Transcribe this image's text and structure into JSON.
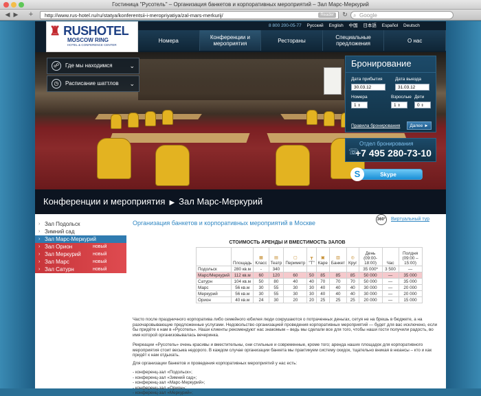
{
  "browser": {
    "title": "Гостиница \"Русотель\" – Организация банкетов и корпоративных мероприятий – Зал Марс-Меркурий",
    "url": "http://www.rus-hotel.ru/ru/statya/konferentsii-i-meropriyatiya/zal-mars-merkurij/",
    "reader": "Reader",
    "search_placeholder": "Google"
  },
  "header": {
    "phone": "8 800 200-05-77",
    "languages": [
      "Русский",
      "English",
      "中国",
      "日本語",
      "Español",
      "Deutsch"
    ],
    "logo": {
      "name": "RUSHOTEL",
      "sub": "MOSCOW RING",
      "tag": "HOTEL & CONFERENCE CENTER"
    },
    "nav": [
      {
        "label": "Номера"
      },
      {
        "label": "Конференции и мероприятия"
      },
      {
        "label": "Рестораны"
      },
      {
        "label": "Специальные предложения"
      },
      {
        "label": "О нас"
      }
    ]
  },
  "hero": {
    "where": "Где мы находимся",
    "shuttle": "Расписание шаттлов"
  },
  "booking": {
    "title": "Бронирование",
    "arrival_label": "Дата прибытия",
    "departure_label": "Дата выезда",
    "arrival": "30.03.12",
    "departure": "31.03.12",
    "rooms_label": "Номера",
    "adults_label": "Взрослые",
    "children_label": "Дети",
    "rooms": "1",
    "adults": "1",
    "children": "0",
    "rules": "Правила бронирования",
    "go": "Далее ►",
    "dept_title": "Отдел бронирования",
    "phone": "+7 495 280-73-10",
    "skype": "Skype"
  },
  "breadcrumb": {
    "section": "Конференции и мероприятия",
    "current": "Зал Марс-Меркурий"
  },
  "menu": {
    "items": [
      {
        "label": "Зал Подольск"
      },
      {
        "label": "Зимний сад"
      },
      {
        "label": "Зал Марс-Меркурий"
      },
      {
        "label": "Зал Орион",
        "badge": "новый"
      },
      {
        "label": "Зал Меркурий",
        "badge": "новый"
      },
      {
        "label": "Зал Марс",
        "badge": "новый"
      },
      {
        "label": "Зал Сатурн",
        "badge": "новый"
      }
    ]
  },
  "main": {
    "title": "Организация банкетов и корпоративных мероприятий в Москве",
    "tour": "Виртуальный тур",
    "tour_badge": "360°",
    "table_caption": "СТОИМОСТЬ АРЕНДЫ И ВМЕСТИМОСТЬ ЗАЛОВ",
    "columns": [
      "",
      "Площадь",
      "Класс",
      "Театр",
      "Периметр",
      "\"Т\"",
      "Каре",
      "Банкет",
      "Круг",
      "День (09:00-18:00)",
      "Час",
      "Полдня (09:00 – 15:00)"
    ],
    "rows": [
      [
        "Подольск",
        "280 кв.м",
        "-",
        "340",
        "",
        "",
        "",
        "",
        "",
        "35 000*",
        "3 500",
        "—"
      ],
      [
        "Марс/Меркурий",
        "112 кв.м",
        "60",
        "120",
        "60",
        "50",
        "85",
        "85",
        "85",
        "50 000",
        "—",
        "35 000"
      ],
      [
        "Сатурн",
        "104 кв.м",
        "50",
        "80",
        "40",
        "40",
        "70",
        "70",
        "70",
        "50 000",
        "—",
        "35 000"
      ],
      [
        "Марс",
        "56 кв.м",
        "30",
        "55",
        "30",
        "30",
        "40",
        "40",
        "40",
        "30 000",
        "—",
        "20 000"
      ],
      [
        "Меркурий",
        "56 кв.м",
        "30",
        "55",
        "30",
        "30",
        "40",
        "40",
        "40",
        "30 000",
        "—",
        "20 000"
      ],
      [
        "Орион",
        "40 кв.м",
        "24",
        "30",
        "20",
        "20",
        "25",
        "25",
        "25",
        "20 000",
        "—",
        "15 000"
      ]
    ],
    "p1": "Часто после праздничного корпоратива либо семейного юбилея люди сокрушаются о потраченных деньгах, сетуя не на брешь в бюджете, а на разочаровывающие предложенные услугами. Недовольство организацией проведения корпоративных мероприятий — будет для вас исключено, если бы придёте к нам в «Русотель». Наши клиенты рекомендуют нас знакомым – ведь мы сделали все для того, чтобы наши гости получили радость, во имя которой организовывалась вечеринка.",
    "p2": "Рекреации «Русотель» очень красивы и вместительны, они стильные и современные, кроме того; аренда наших площадок для корпоративного мероприятия стоит весьма недорого. В каждом случае организации банкета мы практикуем систему скидок, тщательно вникая в нюансы – кто и как придёт к нам отдыхать.",
    "p3": "Для организации банкетов и проведения корпоративных мероприятий у нас есть:",
    "list": [
      "- конференц-зал «Подольск»;",
      "- конференц-зал «Зимний сад»;",
      "- конференц-зал «Марс-Меркурий»;",
      "- конференц-зал «Орион»;",
      "- конференц-зал «Меркурий»;"
    ]
  }
}
